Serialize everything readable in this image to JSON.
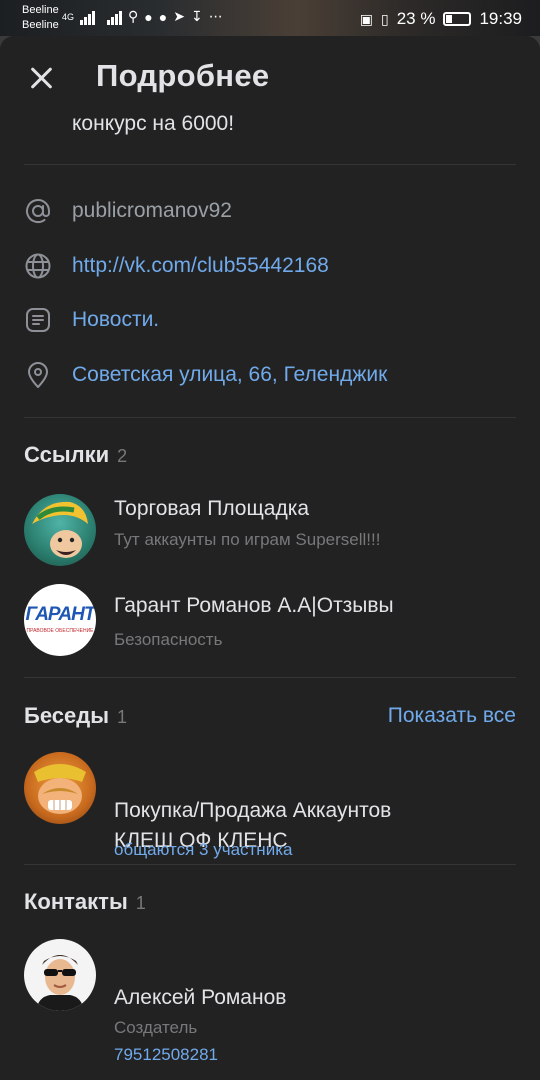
{
  "status_bar": {
    "carrier1": "Beeline",
    "carrier2": "Beeline",
    "net1": "4G",
    "battery": "23 %",
    "time": "19:39"
  },
  "header": {
    "title": "Подробнее"
  },
  "cut_text": "конкурс на 6000!",
  "info": {
    "handle": "publicromanov92",
    "website": "http://vk.com/club55442168",
    "category": "Новости.",
    "address": "Советская улица, 66, Геленджик"
  },
  "links": {
    "title": "Ссылки",
    "count": "2",
    "items": [
      {
        "title": "Торговая Площадка",
        "subtitle": "Тут аккаунты по играм Supersell!!!"
      },
      {
        "title": "Гарант Романов А.А|Отзывы",
        "subtitle": "Безопасность",
        "avatar_text": "ГАРАНТ",
        "avatar_small": "ПРАВОВОЕ ОБЕСПЕЧЕНИЕ"
      }
    ]
  },
  "chats": {
    "title": "Беседы",
    "count": "1",
    "show_all": "Показать все",
    "items": [
      {
        "title_line1": "Покупка/Продажа Аккаунтов",
        "title_line2": "КЛЕШ ОФ КЛЕНС",
        "members": "общаются 3 участника"
      }
    ]
  },
  "contacts": {
    "title": "Контакты",
    "count": "1",
    "items": [
      {
        "name": "Алексей Романов",
        "role": "Создатель",
        "phone": "79512508281"
      }
    ]
  },
  "colors": {
    "background": "#222222",
    "accent": "#71aaeb",
    "text_primary": "#e1e3e6",
    "text_secondary": "#76787a"
  }
}
